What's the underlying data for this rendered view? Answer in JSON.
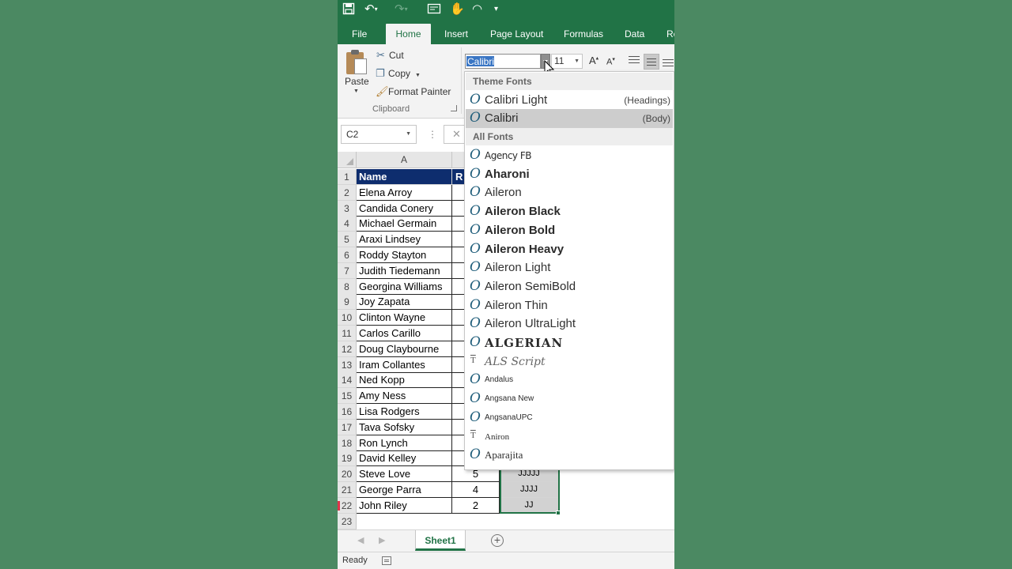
{
  "ribbon_tabs": [
    {
      "label": "File"
    },
    {
      "label": "Home"
    },
    {
      "label": "Insert"
    },
    {
      "label": "Page Layout"
    },
    {
      "label": "Formulas"
    },
    {
      "label": "Data"
    },
    {
      "label": "Re"
    }
  ],
  "clipboard": {
    "paste_label": "Paste",
    "cut_label": "Cut",
    "copy_label": "Copy",
    "format_painter_label": "Format Painter",
    "group_label": "Clipboard"
  },
  "font": {
    "name_value": "Calibri",
    "size_value": "11",
    "grow_label": "A",
    "shrink_label": "A"
  },
  "formula_bar": {
    "name_box": "C2",
    "cancel_glyph": "✕"
  },
  "grid": {
    "columns": [
      "A"
    ],
    "header_row": {
      "num": "1",
      "a": "Name",
      "b": "R"
    },
    "rows": [
      {
        "num": "2",
        "a": "Elena Arroy",
        "b": "",
        "c": ""
      },
      {
        "num": "3",
        "a": "Candida Conery",
        "b": "",
        "c": ""
      },
      {
        "num": "4",
        "a": "Michael Germain",
        "b": "",
        "c": ""
      },
      {
        "num": "5",
        "a": "Araxi Lindsey",
        "b": "",
        "c": ""
      },
      {
        "num": "6",
        "a": "Roddy Stayton",
        "b": "",
        "c": ""
      },
      {
        "num": "7",
        "a": "Judith Tiedemann",
        "b": "",
        "c": ""
      },
      {
        "num": "8",
        "a": "Georgina Williams",
        "b": "",
        "c": ""
      },
      {
        "num": "9",
        "a": "Joy Zapata",
        "b": "",
        "c": ""
      },
      {
        "num": "10",
        "a": "Clinton Wayne",
        "b": "",
        "c": ""
      },
      {
        "num": "11",
        "a": "Carlos Carillo",
        "b": "",
        "c": ""
      },
      {
        "num": "12",
        "a": "Doug Claybourne",
        "b": "",
        "c": ""
      },
      {
        "num": "13",
        "a": "Iram Collantes",
        "b": "",
        "c": ""
      },
      {
        "num": "14",
        "a": "Ned Kopp",
        "b": "",
        "c": ""
      },
      {
        "num": "15",
        "a": "Amy Ness",
        "b": "",
        "c": ""
      },
      {
        "num": "16",
        "a": "Lisa Rodgers",
        "b": "",
        "c": ""
      },
      {
        "num": "17",
        "a": "Tava Sofsky",
        "b": "",
        "c": ""
      },
      {
        "num": "18",
        "a": "Ron Lynch",
        "b": "",
        "c": ""
      },
      {
        "num": "19",
        "a": "David Kelley",
        "b": "",
        "c": ""
      },
      {
        "num": "20",
        "a": "Steve Love",
        "b": "5",
        "c": "JJJJJ"
      },
      {
        "num": "21",
        "a": "George Parra",
        "b": "4",
        "c": "JJJJ"
      },
      {
        "num": "22",
        "a": "John Riley",
        "b": "2",
        "c": "JJ"
      }
    ],
    "empty_row": {
      "num": "23"
    }
  },
  "font_dropdown": {
    "theme_heading": "Theme Fonts",
    "theme_fonts": [
      {
        "name": "Calibri Light",
        "tag": "(Headings)"
      },
      {
        "name": "Calibri",
        "tag": "(Body)"
      }
    ],
    "all_heading": "All Fonts",
    "all_fonts": [
      {
        "name": "Agency FB",
        "icon": "O"
      },
      {
        "name": "Aharoni",
        "icon": "O"
      },
      {
        "name": "Aileron",
        "icon": "O"
      },
      {
        "name": "Aileron Black",
        "icon": "O"
      },
      {
        "name": "Aileron Bold",
        "icon": "O"
      },
      {
        "name": "Aileron Heavy",
        "icon": "O"
      },
      {
        "name": "Aileron Light",
        "icon": "O"
      },
      {
        "name": "Aileron SemiBold",
        "icon": "O"
      },
      {
        "name": "Aileron Thin",
        "icon": "O"
      },
      {
        "name": "Aileron UltraLight",
        "icon": "O"
      },
      {
        "name": "ALGERIAN",
        "icon": "O"
      },
      {
        "name": "ALS Script",
        "icon": "T"
      },
      {
        "name": "Andalus",
        "icon": "O"
      },
      {
        "name": "Angsana New",
        "icon": "O"
      },
      {
        "name": "AngsanaUPC",
        "icon": "O"
      },
      {
        "name": "Aniron",
        "icon": "T"
      },
      {
        "name": "Aparajita",
        "icon": "O"
      }
    ],
    "grip": "....."
  },
  "sheets": {
    "active_tab": "Sheet1",
    "add_glyph": "+"
  },
  "status": {
    "text": "Ready"
  },
  "colors": {
    "brand_green": "#217346",
    "header_fill": "#0e2d6e",
    "background_green": "#4b8962"
  }
}
